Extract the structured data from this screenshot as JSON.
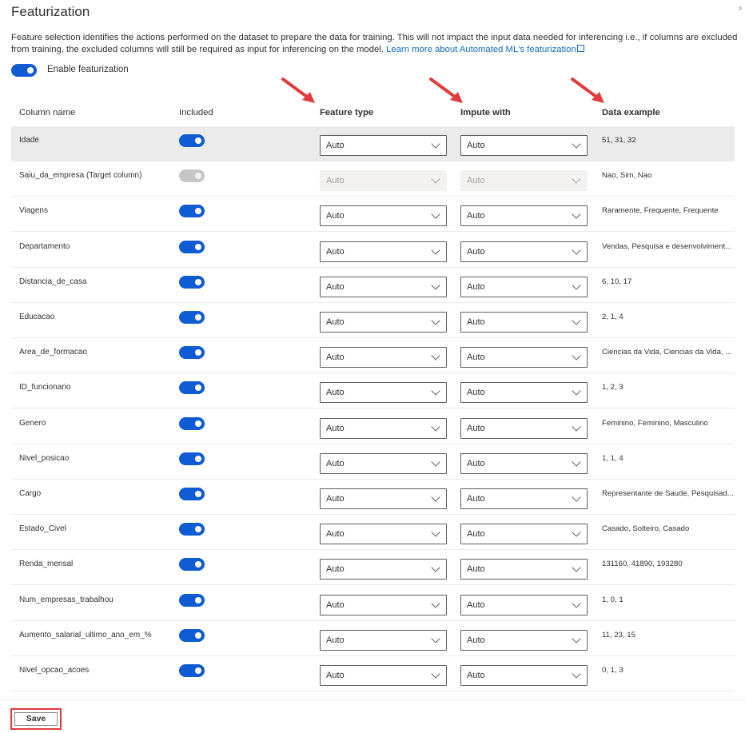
{
  "panel": {
    "title": "Featurization",
    "description": "Feature selection identifies the actions performed on the dataset to prepare the data for training. This will not impact the input data needed for inferencing i.e., if columns are excluded from training, the excluded columns will still be required as input for inferencing on the model.",
    "learn_more_link": "Learn more about Automated ML's featurization",
    "enable_label": "Enable featurization",
    "enable_featurization": true
  },
  "table": {
    "headers": {
      "column_name": "Column name",
      "included": "Included",
      "feature_type": "Feature type",
      "impute_with": "Impute with",
      "data_example": "Data example"
    },
    "rows": [
      {
        "name": "Idade",
        "included": true,
        "disabled": false,
        "feature_type": "Auto",
        "impute_with": "Auto",
        "example": "51, 31, 32"
      },
      {
        "name": "Saiu_da_empresa (Target column)",
        "included": true,
        "disabled": true,
        "feature_type": "Auto",
        "impute_with": "Auto",
        "example": "Nao, Sim, Nao"
      },
      {
        "name": "Viagens",
        "included": true,
        "disabled": false,
        "feature_type": "Auto",
        "impute_with": "Auto",
        "example": "Raramente, Frequente, Frequente"
      },
      {
        "name": "Departamento",
        "included": true,
        "disabled": false,
        "feature_type": "Auto",
        "impute_with": "Auto",
        "example": "Vendas, Pesquisa e desenvolviment..."
      },
      {
        "name": "Distancia_de_casa",
        "included": true,
        "disabled": false,
        "feature_type": "Auto",
        "impute_with": "Auto",
        "example": "6, 10, 17"
      },
      {
        "name": "Educacao",
        "included": true,
        "disabled": false,
        "feature_type": "Auto",
        "impute_with": "Auto",
        "example": "2, 1, 4"
      },
      {
        "name": "Area_de_formacao",
        "included": true,
        "disabled": false,
        "feature_type": "Auto",
        "impute_with": "Auto",
        "example": "Ciencias da Vida, Ciencias da Vida, ..."
      },
      {
        "name": "ID_funcionario",
        "included": true,
        "disabled": false,
        "feature_type": "Auto",
        "impute_with": "Auto",
        "example": "1, 2, 3"
      },
      {
        "name": "Genero",
        "included": true,
        "disabled": false,
        "feature_type": "Auto",
        "impute_with": "Auto",
        "example": "Feminino, Feminino, Masculino"
      },
      {
        "name": "Nivel_posicao",
        "included": true,
        "disabled": false,
        "feature_type": "Auto",
        "impute_with": "Auto",
        "example": "1, 1, 4"
      },
      {
        "name": "Cargo",
        "included": true,
        "disabled": false,
        "feature_type": "Auto",
        "impute_with": "Auto",
        "example": "Representante de Saude, Pesquisad..."
      },
      {
        "name": "Estado_Civel",
        "included": true,
        "disabled": false,
        "feature_type": "Auto",
        "impute_with": "Auto",
        "example": "Casado, Solteiro, Casado"
      },
      {
        "name": "Renda_mensal",
        "included": true,
        "disabled": false,
        "feature_type": "Auto",
        "impute_with": "Auto",
        "example": "131160, 41890, 193280"
      },
      {
        "name": "Num_empresas_trabalhou",
        "included": true,
        "disabled": false,
        "feature_type": "Auto",
        "impute_with": "Auto",
        "example": "1, 0, 1"
      },
      {
        "name": "Aumento_salarial_ultimo_ano_em_%",
        "included": true,
        "disabled": false,
        "feature_type": "Auto",
        "impute_with": "Auto",
        "example": "11, 23, 15"
      },
      {
        "name": "Nivel_opcao_acoes",
        "included": true,
        "disabled": false,
        "feature_type": "Auto",
        "impute_with": "Auto",
        "example": "0, 1, 3"
      }
    ]
  },
  "footer": {
    "save_label": "Save"
  },
  "colors": {
    "toggle_on": "#0f5bd3",
    "link": "#0f6cbd",
    "annotation_red": "#e23b3b"
  }
}
